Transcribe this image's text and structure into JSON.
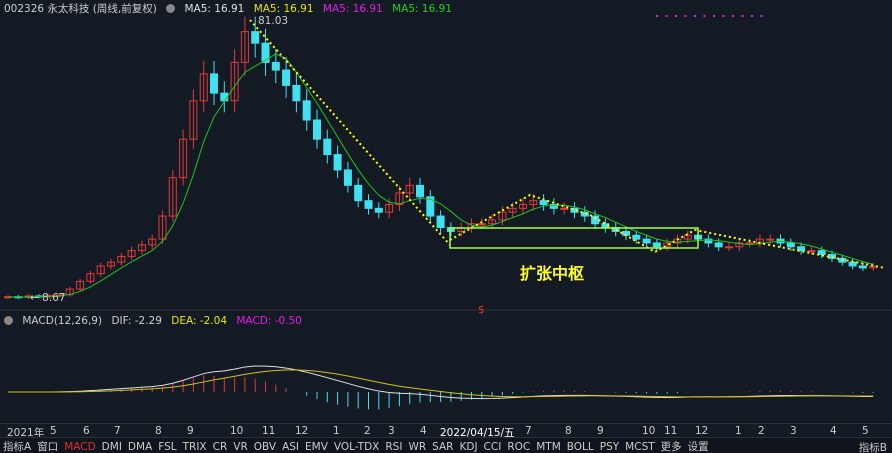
{
  "header": {
    "symbol": "002326 永太科技 (周线,前复权)",
    "ma": [
      {
        "label": "MA5: 16.91",
        "color": "#e0e0e0"
      },
      {
        "label": "MA5: 16.91",
        "color": "#e6e600"
      },
      {
        "label": "MA5: 16.91",
        "color": "#e020e0"
      },
      {
        "label": "MA5: 16.91",
        "color": "#20d020"
      }
    ]
  },
  "macd_header": {
    "name": "MACD(12,26,9)",
    "dif": "DIF: -2.29",
    "dea": "DEA: -2.04",
    "macd": "MACD: -0.50"
  },
  "annotations": {
    "high": "81.03",
    "low": "← 8.67",
    "zone": "扩张中枢",
    "marker": "$"
  },
  "colors": {
    "up": "#e03a3a",
    "down": "#40e0f0",
    "ma": "#20c020",
    "dif": "#e0e0e0",
    "dea": "#d0c020",
    "trend": "#ffff00",
    "zone": "#a0ff40"
  },
  "chart_data": {
    "type": "candlestick",
    "title": "002326 永太科技 (周线,前复权)",
    "ylim": [
      8.67,
      81.03
    ],
    "closes": [
      9.0,
      8.8,
      9.2,
      9.0,
      9.3,
      9.5,
      11,
      13,
      15,
      17,
      18,
      19.5,
      21,
      22.5,
      24,
      30,
      40,
      50,
      60,
      67,
      62,
      60,
      70,
      78,
      75,
      70,
      68,
      64,
      60,
      55,
      50,
      46,
      42,
      38,
      34,
      32,
      31,
      33,
      36,
      38,
      35,
      30,
      27,
      26,
      27,
      28,
      28,
      29,
      31,
      32,
      33,
      34,
      33,
      32,
      32,
      31,
      30,
      28,
      27,
      26,
      25,
      24,
      23,
      22,
      23,
      24,
      25,
      24,
      23,
      22,
      22,
      23,
      23,
      24,
      24,
      23,
      22,
      21,
      21,
      20,
      19,
      18,
      17,
      16.5,
      16.9
    ],
    "x_ticks": [
      "2021年",
      "5",
      "6",
      "7",
      "8",
      "9",
      "10",
      "11",
      "12",
      "1",
      "2",
      "3",
      "4",
      "2022/04/15/五",
      "7",
      "8",
      "9",
      "10",
      "11",
      "12",
      "1",
      "2",
      "3",
      "4",
      "5"
    ]
  },
  "tabs": [
    "指标A",
    "窗口",
    "MACD",
    "DMI",
    "DMA",
    "FSL",
    "TRIX",
    "CR",
    "VR",
    "OBV",
    "ASI",
    "EMV",
    "VOL-TDX",
    "RSI",
    "WR",
    "SAR",
    "KDJ",
    "CCI",
    "ROC",
    "MTM",
    "BOLL",
    "PSY",
    "MCST",
    "更多",
    "设置"
  ],
  "active_tab": "MACD",
  "tab_b": "指标B"
}
